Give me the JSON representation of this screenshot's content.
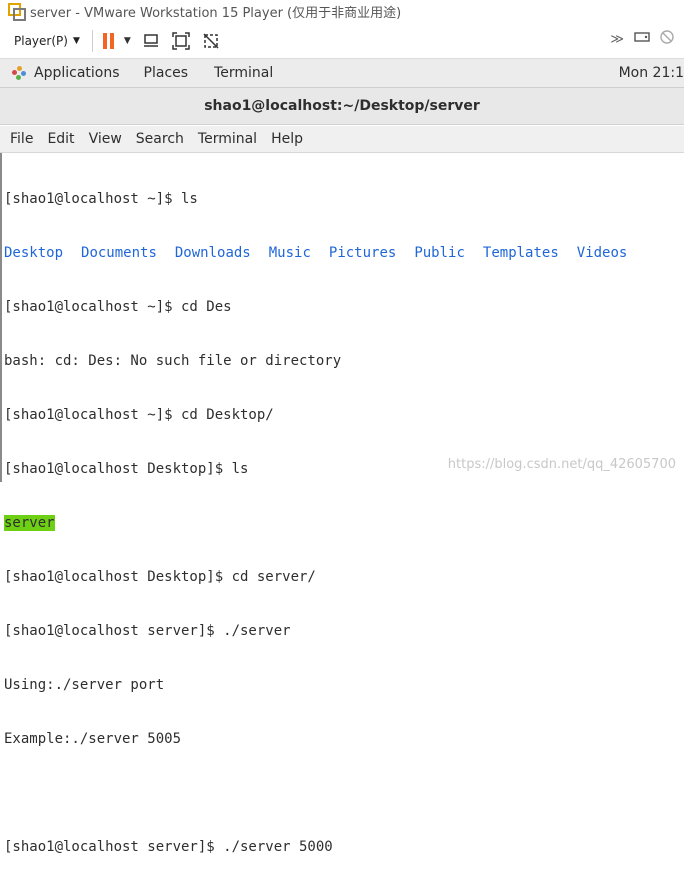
{
  "vm": {
    "title": "server - VMware Workstation 15 Player (仅用于非商业用途)",
    "player_label": "Player(P)",
    "toolbar_icons": [
      "pause-icon",
      "send-keys-icon",
      "fit-guest-icon",
      "unity-icon"
    ],
    "right_icons": [
      "more-icon",
      "removable-devices-icon",
      "disabled-icon"
    ],
    "accent_pause": "#f26522"
  },
  "gnome": {
    "applications": "Applications",
    "places": "Places",
    "terminal": "Terminal",
    "clock": "Mon 21:1"
  },
  "terminal": {
    "title": "shao1@localhost:~/Desktop/server",
    "menu": [
      "File",
      "Edit",
      "View",
      "Search",
      "Terminal",
      "Help"
    ],
    "line1": "[shao1@localhost ~]$ ls",
    "ls_dirs": [
      "Desktop",
      "Documents",
      "Downloads",
      "Music",
      "Pictures",
      "Public",
      "Templates",
      "Videos"
    ],
    "line3": "[shao1@localhost ~]$ cd Des",
    "line4": "bash: cd: Des: No such file or directory",
    "line5": "[shao1@localhost ~]$ cd Desktop/",
    "line6": "[shao1@localhost Desktop]$ ls",
    "line7_highlight": "server",
    "line8": "[shao1@localhost Desktop]$ cd server/",
    "line9": "[shao1@localhost server]$ ./server",
    "line10": "Using:./server port",
    "line11": "Example:./server 5005",
    "line12": "",
    "line13": "[shao1@localhost server]$ ./server 5000",
    "dir_color": "#1f66d8",
    "highlight_color": "#6ed014"
  },
  "watermark": "https://blog.csdn.net/qq_42605700"
}
